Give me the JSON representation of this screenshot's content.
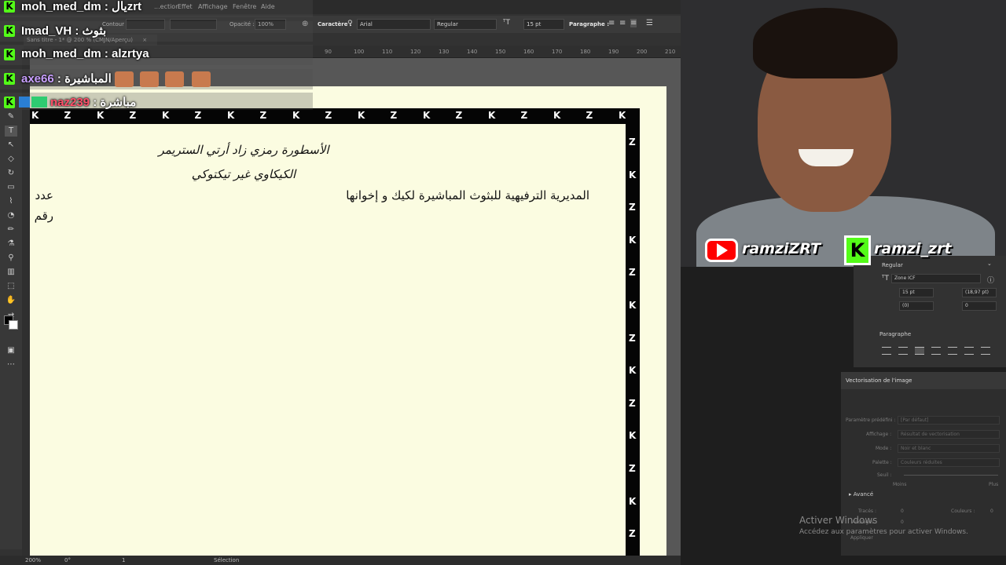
{
  "menu": {
    "items": [
      "...ection",
      "Effet",
      "Affichage",
      "Fenêtre",
      "Aide"
    ]
  },
  "control_bar": {
    "contour_label": "Contour :",
    "opacity_label": "Opacité :",
    "opacity_value": "100%",
    "character_label": "Caractère :",
    "font_family": "Arial",
    "font_style": "Regular",
    "font_size": "15 pt",
    "paragraph_label": "Paragraphe :"
  },
  "document_tab": {
    "title": "Sans titre - 1* @ 200 % (CMJN/Aperçu)",
    "close": "×"
  },
  "ruler_top": {
    "ticks": [
      "90",
      "100",
      "110",
      "120",
      "130",
      "140",
      "150",
      "160",
      "170",
      "180",
      "190",
      "200",
      "210"
    ]
  },
  "artwork": {
    "calligraphy_line1": "الأسطورة رمزي زاد أرتي الستريمر",
    "calligraphy_line2": "الكيكاوي غير تيكتوكي",
    "main_line": "المديرية الترفيهية للبثوث المباشيرة لكيك و إخوانها",
    "label_count": "عدد",
    "label_number": "رقم"
  },
  "chat": {
    "messages": [
      {
        "user": "moh_med_dm",
        "text": "يالzrt"
      },
      {
        "user": "Imad_VH",
        "text": "بثوث"
      },
      {
        "user": "moh_med_dm",
        "text": "alzrtya"
      },
      {
        "user": "axe66",
        "text": "المباشيرة"
      },
      {
        "user": "naz239",
        "text": "مباشرة"
      }
    ]
  },
  "social": {
    "youtube_handle": "ramziZRT",
    "kick_handle": "ramzi_zrt",
    "kick_letter": "K"
  },
  "character_panel": {
    "font_style": "Regular",
    "text_zone": "Zone ICF",
    "size": "15 pt",
    "leading": "(18,97 pt)",
    "kerning": "(0)",
    "tracking": "0"
  },
  "paragraph_panel": {
    "title": "Paragraphe"
  },
  "trace_panel": {
    "title": "Vectorisation de l'image",
    "preset_label": "Paramètre prédéfini :",
    "preset_value": "[Par défaut]",
    "display_label": "Affichage :",
    "display_value": "Résultat de vectorisation",
    "mode_label": "Mode :",
    "mode_value": "Noir et blanc",
    "palette_label": "Palette :",
    "palette_value": "Couleurs réduites",
    "threshold_label": "Seuil :",
    "min_label": "Moins",
    "max_label": "Plus",
    "advanced_label": "Avancé",
    "paths_label": "Tracés :",
    "paths_value": "0",
    "colors_label": "Couleurs :",
    "colors_value": "0",
    "anchors_label": "Ancrages :",
    "anchors_value": "0",
    "apply_label": "Appliquer"
  },
  "status_bar": {
    "zoom": "200%",
    "rotation": "0°",
    "artboard_index": "1",
    "tool": "Sélection"
  },
  "watermark": {
    "line1": "Activer Windows",
    "line2": "Accédez aux paramètres pour activer Windows."
  }
}
